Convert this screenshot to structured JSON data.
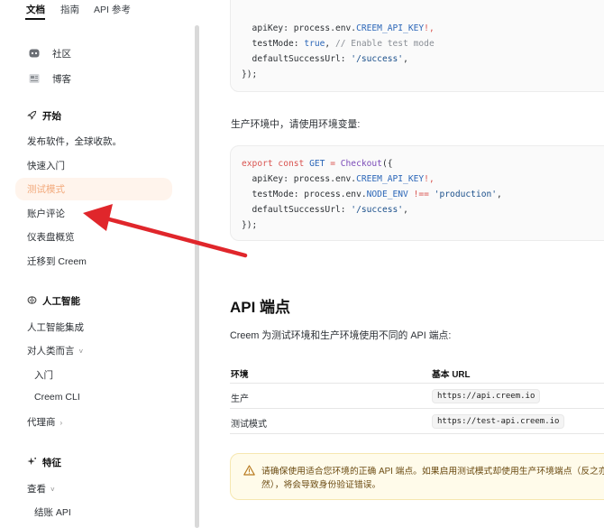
{
  "topnav": {
    "tabs": [
      {
        "label": "文档",
        "active": true
      },
      {
        "label": "指南",
        "active": false
      },
      {
        "label": "API 参考",
        "active": false
      }
    ]
  },
  "sidebar": {
    "links": [
      {
        "label": "社区",
        "icon": "discord-icon"
      },
      {
        "label": "博客",
        "icon": "newspaper-icon"
      }
    ],
    "section_start": {
      "label": "开始",
      "icon": "rocket-icon"
    },
    "start_items": [
      "发布软件，全球收款。",
      "快速入门",
      "测试模式",
      "账户评论",
      "仪表盘概览",
      "迁移到 Creem"
    ],
    "active_item": "测试模式",
    "section_ai": {
      "label": "人工智能",
      "icon": "brain-icon"
    },
    "ai_items": [
      {
        "label": "人工智能集成"
      },
      {
        "label": "对人类而言",
        "chevron": "˅"
      },
      {
        "label": "入门",
        "sub": true
      },
      {
        "label": "Creem CLI",
        "sub": true
      },
      {
        "label": "代理商",
        "chevron": "›"
      }
    ],
    "section_features": {
      "label": "特征",
      "icon": "sparkle-icon"
    },
    "feature_items": [
      {
        "label": "查看",
        "chevron": "˅"
      },
      {
        "label": "结账 API",
        "sub": true
      }
    ]
  },
  "content": {
    "code1": {
      "line1": {
        "a": "  apiKey: process.env.",
        "b": "CREEM_API_KEY",
        "c": "!,"
      },
      "line2": {
        "a": "  testMode: ",
        "b": "true",
        "c": ", ",
        "d": "// Enable test mode"
      },
      "line3": {
        "a": "  defaultSuccessUrl: ",
        "b": "'/success'",
        "c": ","
      },
      "line4": "});"
    },
    "prod_paragraph": "生产环境中，请使用环境变量:",
    "code2": {
      "line1": {
        "a": "export const ",
        "b": "GET",
        "c": " = ",
        "d": "Checkout",
        "e": "({"
      },
      "line2": {
        "a": "  apiKey: process.env.",
        "b": "CREEM_API_KEY",
        "c": "!,"
      },
      "line3": {
        "a": "  testMode: process.env.",
        "b": "NODE_ENV",
        "c": " !== ",
        "d": "'production'",
        "e": ","
      },
      "line4": {
        "a": "  defaultSuccessUrl: ",
        "b": "'/success'",
        "c": ","
      },
      "line5": "});"
    },
    "api_heading": "API 端点",
    "api_paragraph": "Creem 为测试环境和生产环境使用不同的 API 端点:",
    "table": {
      "headers": [
        "环境",
        "基本 URL"
      ],
      "rows": [
        {
          "env": "生产",
          "url": "https://api.creem.io"
        },
        {
          "env": "测试模式",
          "url": "https://test-api.creem.io"
        }
      ]
    },
    "warning_text": "请确保使用适合您环境的正确 API 端点。如果启用测试模式却使用生产环境端点（反之亦然），将会导致身份验证错误。"
  },
  "colors": {
    "accent": "#f2a97b",
    "arrow": "#e0262b",
    "active_bg": "#fff4ec"
  }
}
